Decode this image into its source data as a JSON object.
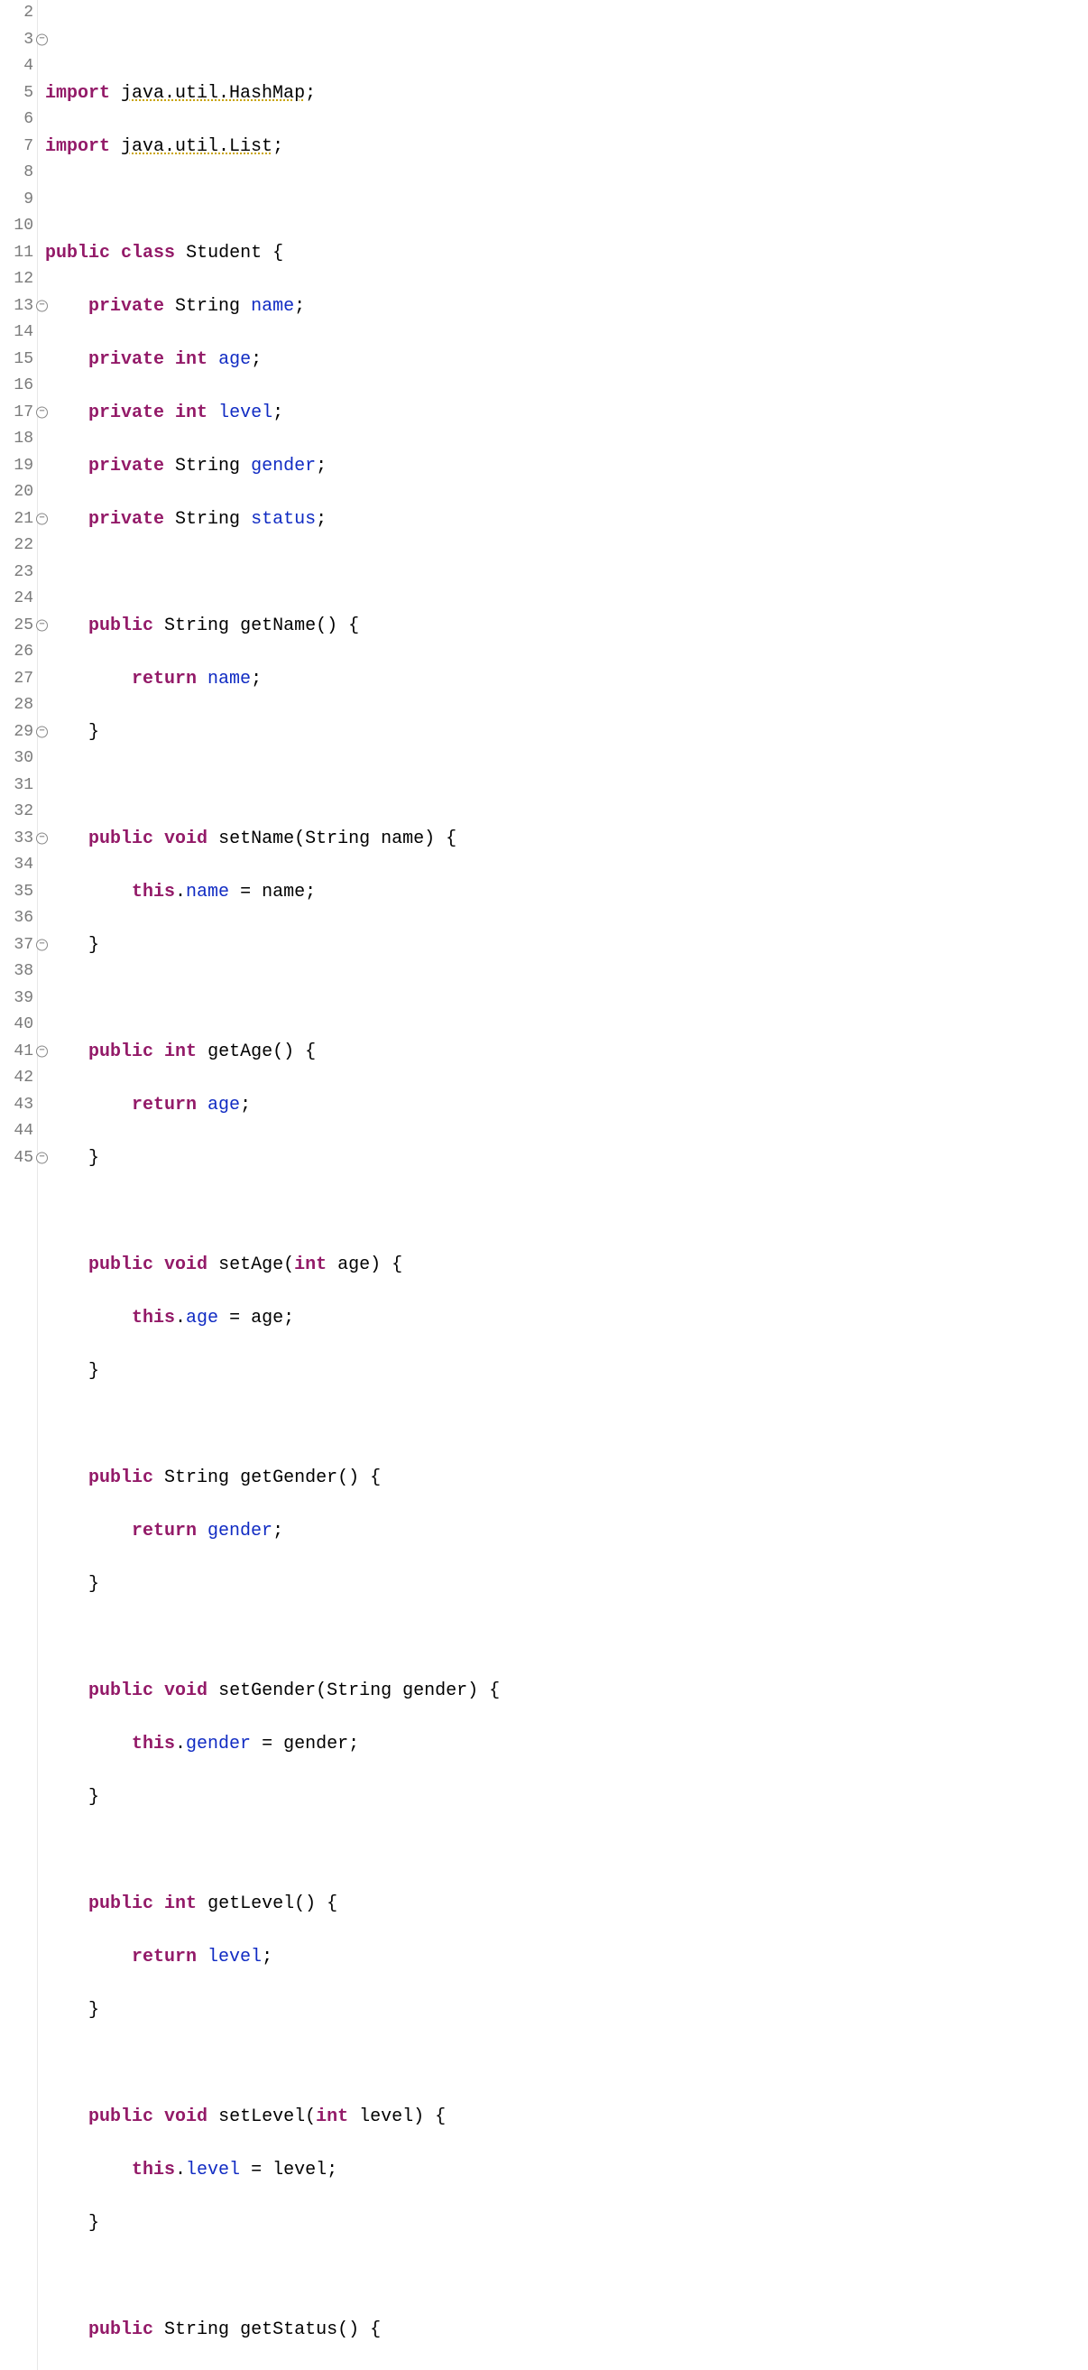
{
  "editor": {
    "lines": [
      {
        "num": 2,
        "fold": false
      },
      {
        "num": 3,
        "fold": true
      },
      {
        "num": 4,
        "fold": false
      },
      {
        "num": 5,
        "fold": false
      },
      {
        "num": 6,
        "fold": false
      },
      {
        "num": 7,
        "fold": false
      },
      {
        "num": 8,
        "fold": false
      },
      {
        "num": 9,
        "fold": false
      },
      {
        "num": 10,
        "fold": false
      },
      {
        "num": 11,
        "fold": false
      },
      {
        "num": 12,
        "fold": false
      },
      {
        "num": 13,
        "fold": true
      },
      {
        "num": 14,
        "fold": false
      },
      {
        "num": 15,
        "fold": false
      },
      {
        "num": 16,
        "fold": false
      },
      {
        "num": 17,
        "fold": true
      },
      {
        "num": 18,
        "fold": false
      },
      {
        "num": 19,
        "fold": false
      },
      {
        "num": 20,
        "fold": false
      },
      {
        "num": 21,
        "fold": true
      },
      {
        "num": 22,
        "fold": false
      },
      {
        "num": 23,
        "fold": false
      },
      {
        "num": 24,
        "fold": false
      },
      {
        "num": 25,
        "fold": true
      },
      {
        "num": 26,
        "fold": false
      },
      {
        "num": 27,
        "fold": false
      },
      {
        "num": 28,
        "fold": false
      },
      {
        "num": 29,
        "fold": true
      },
      {
        "num": 30,
        "fold": false
      },
      {
        "num": 31,
        "fold": false
      },
      {
        "num": 32,
        "fold": false
      },
      {
        "num": 33,
        "fold": true
      },
      {
        "num": 34,
        "fold": false
      },
      {
        "num": 35,
        "fold": false
      },
      {
        "num": 36,
        "fold": false
      },
      {
        "num": 37,
        "fold": true
      },
      {
        "num": 38,
        "fold": false
      },
      {
        "num": 39,
        "fold": false
      },
      {
        "num": 40,
        "fold": false
      },
      {
        "num": 41,
        "fold": true
      },
      {
        "num": 42,
        "fold": false
      },
      {
        "num": 43,
        "fold": false
      },
      {
        "num": 44,
        "fold": false
      },
      {
        "num": 45,
        "fold": true
      }
    ],
    "tokens": {
      "kw_import": "import",
      "kw_public": "public",
      "kw_private": "private",
      "kw_class": "class",
      "kw_void": "void",
      "kw_int": "int",
      "kw_return": "return",
      "kw_this": "this",
      "type_string": "String",
      "import1_pkg": "java.util.HashMap",
      "import2_pkg": "java.util.List",
      "class_name": "Student",
      "field_name": "name",
      "field_age": "age",
      "field_level": "level",
      "field_gender": "gender",
      "field_status": "status",
      "m_getName": "getName",
      "m_setName": "setName",
      "m_getAge": "getAge",
      "m_setAge": "setAge",
      "m_getGender": "getGender",
      "m_setGender": "setGender",
      "m_getLevel": "getLevel",
      "m_setLevel": "setLevel",
      "m_getStatus": "getStatus",
      "p_name": "name",
      "p_age": "age",
      "p_gender": "gender",
      "p_level": "level"
    }
  }
}
